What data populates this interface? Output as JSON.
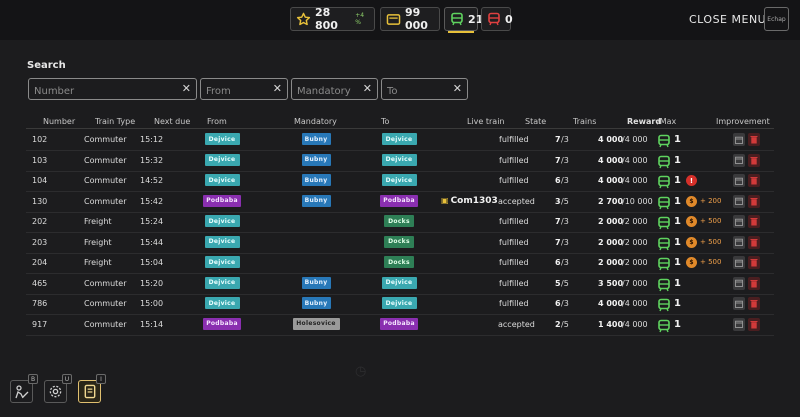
{
  "topbar": {
    "score": "28 800",
    "score_delta": "+4 %",
    "money": "99 000",
    "trains_green": "21",
    "trains_red": "0",
    "close_label": "CLOSE MENU",
    "close_key": "Echap"
  },
  "search": {
    "title": "Search",
    "fields": [
      {
        "placeholder": "Number",
        "value": ""
      },
      {
        "placeholder": "From",
        "value": ""
      },
      {
        "placeholder": "Mandatory",
        "value": ""
      },
      {
        "placeholder": "To",
        "value": ""
      }
    ]
  },
  "table": {
    "headers": [
      "Number",
      "Train Type",
      "Next due",
      "From",
      "Mandatory",
      "To",
      "Live train",
      "State",
      "Trains",
      "Reward",
      "/Max",
      "Improvement"
    ],
    "rows": [
      {
        "number": "102",
        "type": "Commuter",
        "due": "15:12",
        "from": "Dejvice",
        "mandatory": "Bubny",
        "to": "Dejvice",
        "live": "",
        "state": "fulfilled",
        "trains_a": "7",
        "trains_b": "/3",
        "reward": "4 000",
        "max": "/4 000",
        "count": "1",
        "bonus": ""
      },
      {
        "number": "103",
        "type": "Commuter",
        "due": "15:32",
        "from": "Dejvice",
        "mandatory": "Bubny",
        "to": "Dejvice",
        "live": "",
        "state": "fulfilled",
        "trains_a": "7",
        "trains_b": "/3",
        "reward": "4 000",
        "max": "/4 000",
        "count": "1",
        "bonus": ""
      },
      {
        "number": "104",
        "type": "Commuter",
        "due": "14:52",
        "from": "Dejvice",
        "mandatory": "Bubny",
        "to": "Dejvice",
        "live": "",
        "state": "fulfilled",
        "trains_a": "6",
        "trains_b": "/3",
        "reward": "4 000",
        "max": "/4 000",
        "count": "1",
        "bonus": "alert"
      },
      {
        "number": "130",
        "type": "Commuter",
        "due": "15:42",
        "from": "Podbaba",
        "mandatory": "Bubny",
        "to": "Podbaba",
        "live": "Com1303",
        "state": "accepted",
        "trains_a": "3",
        "trains_b": "/5",
        "reward": "2 700",
        "max": "/10 000",
        "count": "1",
        "bonus": "+ 200"
      },
      {
        "number": "202",
        "type": "Freight",
        "due": "15:24",
        "from": "Dejvice",
        "mandatory": "",
        "to": "Docks",
        "live": "",
        "state": "fulfilled",
        "trains_a": "7",
        "trains_b": "/3",
        "reward": "2 000",
        "max": "/2 000",
        "count": "1",
        "bonus": "+ 500"
      },
      {
        "number": "203",
        "type": "Freight",
        "due": "15:44",
        "from": "Dejvice",
        "mandatory": "",
        "to": "Docks",
        "live": "",
        "state": "fulfilled",
        "trains_a": "7",
        "trains_b": "/3",
        "reward": "2 000",
        "max": "/2 000",
        "count": "1",
        "bonus": "+ 500"
      },
      {
        "number": "204",
        "type": "Freight",
        "due": "15:04",
        "from": "Dejvice",
        "mandatory": "",
        "to": "Docks",
        "live": "",
        "state": "fulfilled",
        "trains_a": "6",
        "trains_b": "/3",
        "reward": "2 000",
        "max": "/2 000",
        "count": "1",
        "bonus": "+ 500"
      },
      {
        "number": "465",
        "type": "Commuter",
        "due": "15:20",
        "from": "Dejvice",
        "mandatory": "Bubny",
        "to": "Dejvice",
        "live": "",
        "state": "fulfilled",
        "trains_a": "5",
        "trains_b": "/5",
        "reward": "3 500",
        "max": "/7 000",
        "count": "1",
        "bonus": ""
      },
      {
        "number": "786",
        "type": "Commuter",
        "due": "15:00",
        "from": "Dejvice",
        "mandatory": "Bubny",
        "to": "Dejvice",
        "live": "",
        "state": "fulfilled",
        "trains_a": "6",
        "trains_b": "/3",
        "reward": "4 000",
        "max": "/4 000",
        "count": "1",
        "bonus": ""
      },
      {
        "number": "917",
        "type": "Commuter",
        "due": "15:14",
        "from": "Podbaba",
        "mandatory": "Holesovice",
        "to": "Podbaba",
        "live": "",
        "state": "accepted",
        "trains_a": "2",
        "trains_b": "/5",
        "reward": "1 400",
        "max": "/4 000",
        "count": "1",
        "bonus": ""
      }
    ]
  },
  "bottom": {
    "buttons": [
      {
        "key": "B",
        "icon": "builder-icon"
      },
      {
        "key": "U",
        "icon": "gear-icon"
      },
      {
        "key": "I",
        "icon": "ledger-icon"
      }
    ]
  }
}
